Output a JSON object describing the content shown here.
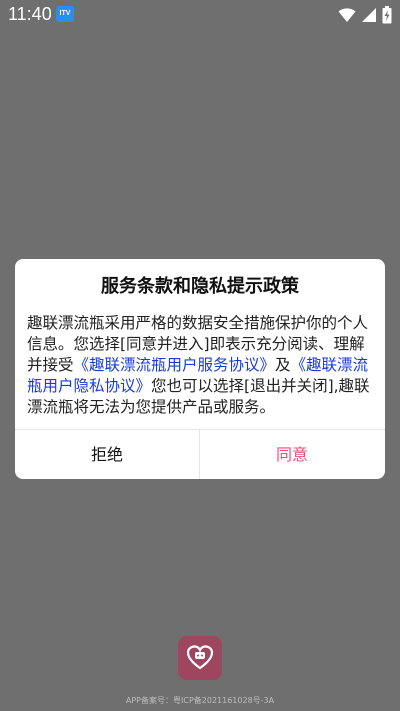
{
  "status_bar": {
    "time": "11:40",
    "app_badge": "ITV"
  },
  "dialog": {
    "title": "服务条款和隐私提示政策",
    "body": {
      "text_1": "趣联漂流瓶采用严格的数据安全措施保护你的个人信息。您选择[同意并进入]即表示充分阅读、理解并接受",
      "link_service": "《趣联漂流瓶用户服务协议》",
      "text_2": "及",
      "link_privacy": "《趣联漂流瓶用户隐私协议》",
      "text_3": "您也可以选择[退出并关闭],趣联漂流瓶将无法为您提供产品或服务。"
    },
    "refuse_label": "拒绝",
    "agree_label": "同意"
  },
  "footer": {
    "icp": "APP备案号：粤ICP备2021161028号-3A"
  },
  "colors": {
    "overlay": "#6f6f6f",
    "link": "#1a3bd9",
    "agree": "#ef4d78",
    "logo": "#9e4560"
  },
  "icons": [
    "wifi-icon",
    "signal-icon",
    "battery-charging-icon",
    "app-logo-heart-icon"
  ]
}
